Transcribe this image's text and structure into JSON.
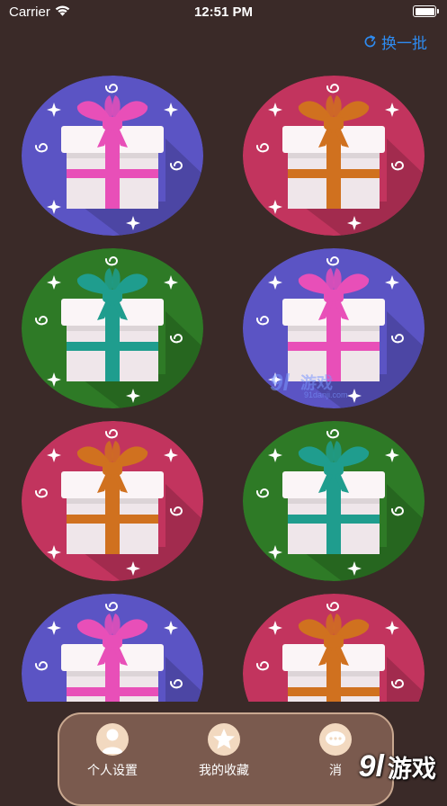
{
  "status_bar": {
    "carrier": "Carrier",
    "time": "12:51 PM"
  },
  "header": {
    "refresh_label": "换一批",
    "refresh_icon": "refresh-icon",
    "accent_color": "#2e8bf0"
  },
  "gifts": [
    {
      "color": "purple",
      "background": "#5b54c4",
      "ribbon": "#e84fb8"
    },
    {
      "color": "red",
      "background": "#c2345e",
      "ribbon": "#d0711f"
    },
    {
      "color": "green",
      "background": "#2e7a26",
      "ribbon": "#1f9d8e"
    },
    {
      "color": "purple",
      "background": "#5b54c4",
      "ribbon": "#e84fb8"
    },
    {
      "color": "red",
      "background": "#c2345e",
      "ribbon": "#d0711f"
    },
    {
      "color": "green",
      "background": "#2e7a26",
      "ribbon": "#1f9d8e"
    },
    {
      "color": "purple",
      "background": "#5b54c4",
      "ribbon": "#e84fb8"
    },
    {
      "color": "red",
      "background": "#c2345e",
      "ribbon": "#d0711f"
    }
  ],
  "tab_bar": {
    "tabs": [
      {
        "label": "个人设置",
        "icon": "user-icon"
      },
      {
        "label": "我的收藏",
        "icon": "star-icon"
      },
      {
        "label": "消",
        "icon": "chat-icon"
      }
    ]
  },
  "watermarks": {
    "center": {
      "mark": "9l",
      "name": "游戏",
      "url": "91danji.com"
    },
    "corner": {
      "mark": "9l",
      "name": "游戏"
    }
  }
}
